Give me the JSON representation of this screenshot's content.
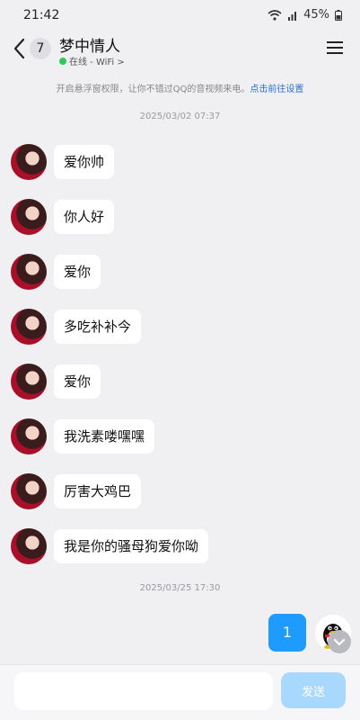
{
  "status_bar": {
    "time": "21:42",
    "battery": "45%"
  },
  "header": {
    "unread_count": "7",
    "contact_name": "梦中情人",
    "contact_status": "在线 - WiFi >",
    "back_icon": "chevron-left-icon",
    "menu_icon": "hamburger-menu-icon"
  },
  "notice": {
    "text": "开启悬浮窗权限，让你不错过QQ的音视频来电。",
    "link": "点击前往设置"
  },
  "timestamps": [
    "2025/03/02 07:37",
    "2025/03/25 17:30"
  ],
  "messages": [
    {
      "text": "爱你帅"
    },
    {
      "text": "你人好"
    },
    {
      "text": "爱你"
    },
    {
      "text": "多吃补补今"
    },
    {
      "text": "爱你"
    },
    {
      "text": "我洗素喽嘿嘿"
    },
    {
      "text": "厉害大鸡巴"
    },
    {
      "text": "我是你的骚母狗爱你呦"
    }
  ],
  "my_message": {
    "text": "1"
  },
  "input": {
    "placeholder": "",
    "send_label": "发送"
  },
  "colors": {
    "accent": "#1e9bff",
    "send_disabled": "#a9d8ff",
    "online": "#2fc85a",
    "link": "#2c6fd0"
  }
}
